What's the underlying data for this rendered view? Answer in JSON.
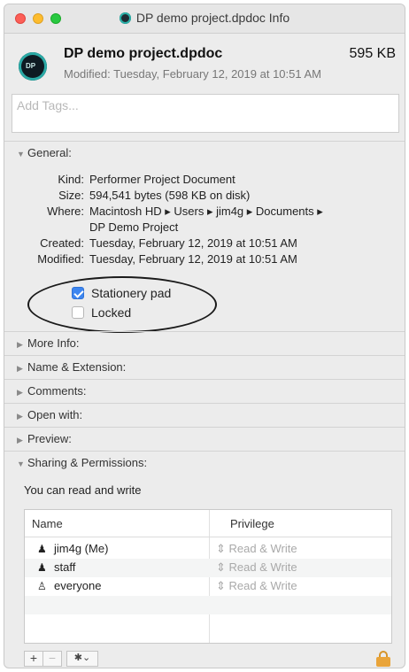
{
  "window": {
    "title": "DP demo project.dpdoc Info",
    "colors": {
      "close": "#fc5f57",
      "minimize": "#fdbc2e",
      "zoom": "#28c840",
      "checkbox_on": "#3d86f0",
      "lock": "#e9a43a"
    }
  },
  "header": {
    "file_name": "DP demo project.dpdoc",
    "file_size": "595 KB",
    "modified": "Modified: Tuesday, February 12, 2019 at 10:51 AM",
    "icon_label": "DP"
  },
  "tags": {
    "placeholder": "Add Tags..."
  },
  "general": {
    "label": "General:",
    "rows": [
      {
        "key": "Kind:",
        "value": "Performer Project Document"
      },
      {
        "key": "Size:",
        "value": "594,541 bytes (598 KB on disk)"
      },
      {
        "key": "Where:",
        "value": "Macintosh HD ▸ Users ▸ jim4g ▸ Documents ▸"
      },
      {
        "key": "",
        "value": "DP Demo Project"
      },
      {
        "key": "Created:",
        "value": "Tuesday, February 12, 2019 at 10:51 AM"
      },
      {
        "key": "Modified:",
        "value": "Tuesday, February 12, 2019 at 10:51 AM"
      }
    ],
    "stationery_pad": {
      "label": "Stationery pad",
      "checked": true
    },
    "locked": {
      "label": "Locked",
      "checked": false
    }
  },
  "sections": {
    "more_info": "More Info:",
    "name_extension": "Name & Extension:",
    "comments": "Comments:",
    "open_with": "Open with:",
    "preview": "Preview:",
    "sharing": "Sharing & Permissions:"
  },
  "permissions": {
    "summary": "You can read and write",
    "col_name": "Name",
    "col_privilege": "Privilege",
    "rows": [
      {
        "name": "jim4g (Me)",
        "icon": "user-icon",
        "privilege": "Read & Write"
      },
      {
        "name": "staff",
        "icon": "group-icon",
        "privilege": "Read & Write"
      },
      {
        "name": "everyone",
        "icon": "everyone-icon",
        "privilege": "Read & Write"
      }
    ]
  },
  "toolbar": {
    "add": "+",
    "remove": "−",
    "action": "✱⌄"
  }
}
